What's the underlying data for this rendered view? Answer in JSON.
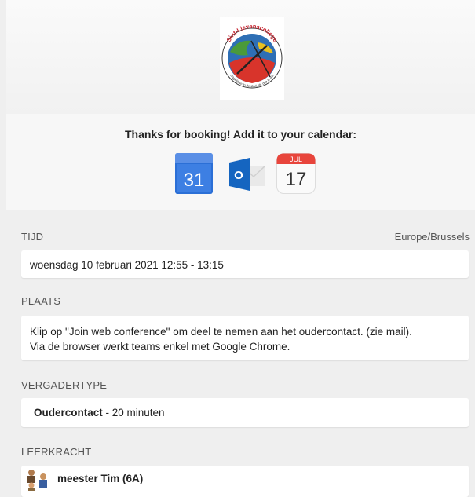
{
  "logo": {
    "name": "Sint-Lievenscollege",
    "motto": "Dagelijkse in de stad, de doe je dat"
  },
  "booking": {
    "title": "Thanks for booking! Add it to your calendar:",
    "google_calendar": {
      "day": "31",
      "icon": "google-calendar-icon"
    },
    "outlook": {
      "letter": "O",
      "icon": "outlook-icon"
    },
    "ical": {
      "month": "JUL",
      "day": "17",
      "icon": "apple-calendar-icon"
    }
  },
  "time": {
    "label": "TIJD",
    "timezone": "Europe/Brussels",
    "value": "woensdag 10 februari 2021 12:55 - 13:15"
  },
  "place": {
    "label": "PLAATS",
    "line1": "Klip op \"Join web conference\" om deel te nemen aan het oudercontact. (zie mail).",
    "line2": "Via de browser werkt teams enkel met Google Chrome."
  },
  "meeting_type": {
    "label": "VERGADERTYPE",
    "name": "Oudercontact",
    "duration": " - 20 minuten"
  },
  "teacher": {
    "label": "LEERKRACHT",
    "name": "meester Tim (6A)"
  },
  "colors": {
    "background": "#efefef",
    "card": "#ffffff",
    "google_blue": "#4285f4",
    "outlook_blue": "#0a64c8",
    "ical_red": "#e8453c"
  }
}
